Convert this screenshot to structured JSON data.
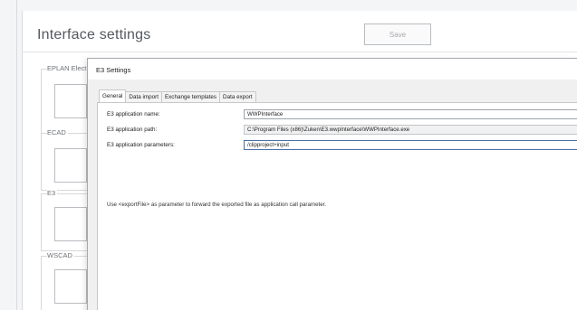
{
  "header": {
    "title": "Interface settings",
    "save_label": "Save"
  },
  "groups": [
    {
      "label": "EPLAN Elect"
    },
    {
      "label": "ECAD"
    },
    {
      "label": "E3"
    },
    {
      "label": "WSCAD"
    }
  ],
  "dialog": {
    "title": "E3 Settings",
    "tabs": [
      {
        "label": "General",
        "active": true
      },
      {
        "label": "Data import",
        "active": false
      },
      {
        "label": "Exchange templates",
        "active": false
      },
      {
        "label": "Data export",
        "active": false
      }
    ],
    "fields": {
      "app_name": {
        "label": "E3 application name:",
        "value": "WWPInterface"
      },
      "app_path": {
        "label": "E3 application path:",
        "value": "C:\\Program Files (x86)\\Zuken\\E3.wwpInterface\\WWPInterface.exe"
      },
      "app_params": {
        "label": "E3 application parameters:",
        "value": "/clipproject+input"
      }
    },
    "hint": "Use <exportFile> as parameter to forward the exported file as application call parameter."
  }
}
